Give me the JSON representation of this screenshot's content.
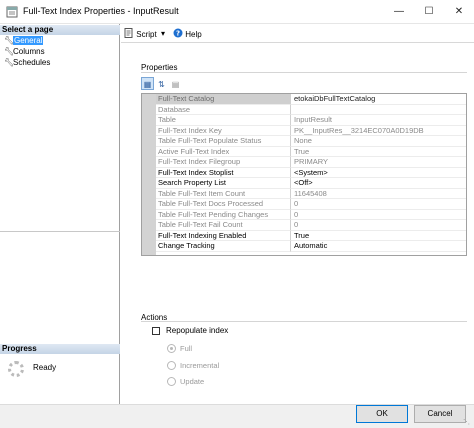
{
  "window": {
    "title": "Full-Text Index Properties - InputResult",
    "minimize_glyph": "—",
    "maximize_glyph": "☐",
    "close_glyph": "✕"
  },
  "left_pane": {
    "header": "Select a page",
    "pages": [
      {
        "label": "General",
        "selected": true
      },
      {
        "label": "Columns",
        "selected": false
      },
      {
        "label": "Schedules",
        "selected": false
      }
    ]
  },
  "toolbar": {
    "script_label": "Script",
    "dropdown_glyph": "▾",
    "help_label": "Help"
  },
  "properties": {
    "label": "Properties",
    "rows": [
      {
        "name": "Full-Text Catalog",
        "value": "etokaiDbFullTextCatalog",
        "readonly": true,
        "selected": true
      },
      {
        "name": "Database",
        "value": "",
        "readonly": true,
        "selected": false
      },
      {
        "name": "Table",
        "value": "InputResult",
        "readonly": true,
        "selected": false
      },
      {
        "name": "Full-Text Index Key",
        "value": "PK__InputRes__3214EC070A0D19DB",
        "readonly": true,
        "selected": false
      },
      {
        "name": "Table Full-Text Populate Status",
        "value": "None",
        "readonly": true,
        "selected": false
      },
      {
        "name": "Active Full-Text Index",
        "value": "True",
        "readonly": true,
        "selected": false
      },
      {
        "name": "Full-Text Index Filegroup",
        "value": "PRIMARY",
        "readonly": true,
        "selected": false
      },
      {
        "name": "Full-Text Index Stoplist",
        "value": "<System>",
        "readonly": false,
        "selected": false
      },
      {
        "name": "Search Property List",
        "value": "<Off>",
        "readonly": false,
        "selected": false
      },
      {
        "name": "Table Full-Text Item Count",
        "value": "11645408",
        "readonly": true,
        "selected": false
      },
      {
        "name": "Table Full-Text Docs Processed",
        "value": "0",
        "readonly": true,
        "selected": false
      },
      {
        "name": "Table Full-Text Pending Changes",
        "value": "0",
        "readonly": true,
        "selected": false
      },
      {
        "name": "Table Full-Text Fail Count",
        "value": "0",
        "readonly": true,
        "selected": false
      },
      {
        "name": "Full-Text Indexing Enabled",
        "value": "True",
        "readonly": false,
        "selected": false
      },
      {
        "name": "Change Tracking",
        "value": "Automatic",
        "readonly": false,
        "selected": false
      }
    ]
  },
  "actions": {
    "label": "Actions",
    "repopulate_label": "Repopulate index",
    "repopulate_checked": false,
    "options": [
      {
        "label": "Full",
        "checked": true
      },
      {
        "label": "Incremental",
        "checked": false
      },
      {
        "label": "Update",
        "checked": false
      }
    ]
  },
  "progress": {
    "header": "Progress",
    "status": "Ready"
  },
  "footer": {
    "ok_label": "OK",
    "cancel_label": "Cancel"
  }
}
